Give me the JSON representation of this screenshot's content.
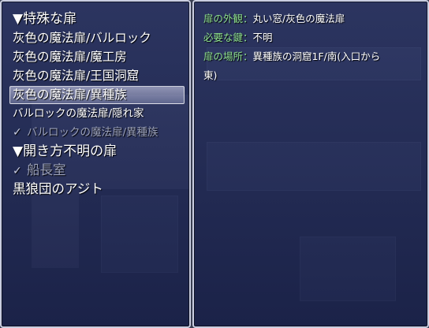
{
  "door_list": {
    "items": [
      {
        "label": "▼特殊な扉",
        "style": "heading",
        "checked": false,
        "selected": false,
        "disabled": false
      },
      {
        "label": "灰色の魔法扉/バルロック",
        "style": "normal",
        "checked": false,
        "selected": false,
        "disabled": false
      },
      {
        "label": "灰色の魔法扉/魔工房",
        "style": "normal",
        "checked": false,
        "selected": false,
        "disabled": false
      },
      {
        "label": "灰色の魔法扉/王国洞窟",
        "style": "normal",
        "checked": false,
        "selected": false,
        "disabled": false
      },
      {
        "label": "灰色の魔法扉/異種族",
        "style": "normal",
        "checked": false,
        "selected": true,
        "disabled": false
      },
      {
        "label": "バルロックの魔法扉/隠れ家",
        "style": "small",
        "checked": false,
        "selected": false,
        "disabled": false
      },
      {
        "label": "バルロックの魔法扉/異種族",
        "style": "small",
        "checked": true,
        "selected": false,
        "disabled": true
      },
      {
        "label": "▼開き方不明の扉",
        "style": "heading",
        "checked": false,
        "selected": false,
        "disabled": false
      },
      {
        "label": "船長室",
        "style": "big",
        "checked": true,
        "selected": false,
        "disabled": true
      },
      {
        "label": "黒狼団のアジト",
        "style": "big",
        "checked": false,
        "selected": false,
        "disabled": false
      }
    ],
    "check_mark": "✓"
  },
  "details": {
    "appearance_label": "扉の外観：",
    "appearance_value": "丸い窓/灰色の魔法扉",
    "key_label": "必要な鍵：",
    "key_value": "不明",
    "location_label": "扉の場所：",
    "location_value": "異種族の洞窟1F/南(入口から",
    "location_value_cont": "東)"
  }
}
